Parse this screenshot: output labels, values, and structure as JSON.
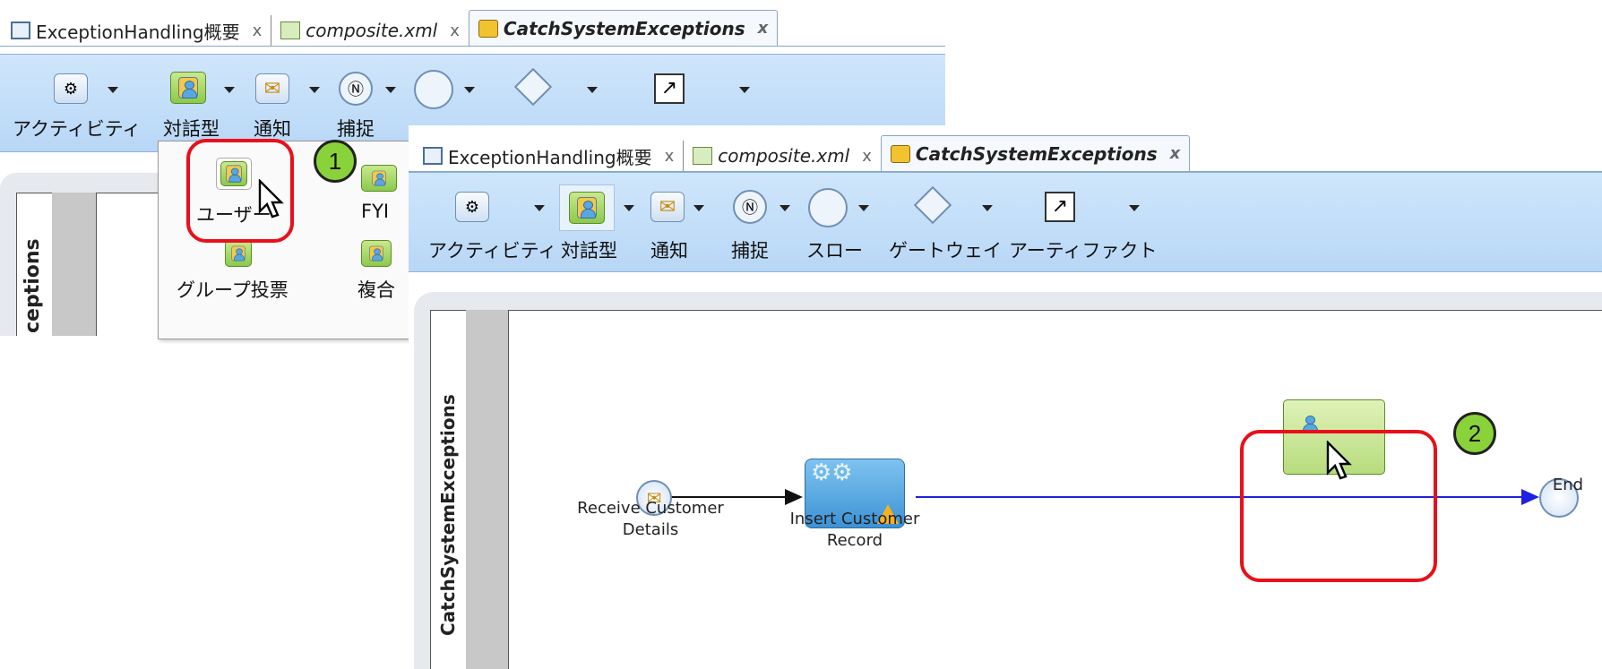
{
  "tabs": [
    {
      "label": "ExceptionHandling概要",
      "close": "x"
    },
    {
      "label": "composite.xml",
      "close": "x"
    },
    {
      "label": "CatchSystemExceptions",
      "close": "x"
    }
  ],
  "toolbar": {
    "items": [
      "アクティビティ",
      "対話型",
      "通知",
      "捕捉",
      "スロー",
      "ゲートウェイ",
      "アーティファクト"
    ]
  },
  "dropdown": {
    "items": [
      "ユーザー",
      "FYI",
      "グループ投票",
      "複合"
    ]
  },
  "pool": {
    "title": "CatchSystemExceptions",
    "back_title": "ceptions"
  },
  "diagram": {
    "start_label": "Receive Customer Details",
    "task_label": "Insert Customer Record",
    "end_label": "End"
  },
  "callouts": {
    "one": "1",
    "two": "2"
  },
  "colors": {
    "highlight": "#e8101a",
    "callout": "#8ad23a",
    "flow": "#2020e0",
    "toolbar": "#c4dff8"
  }
}
